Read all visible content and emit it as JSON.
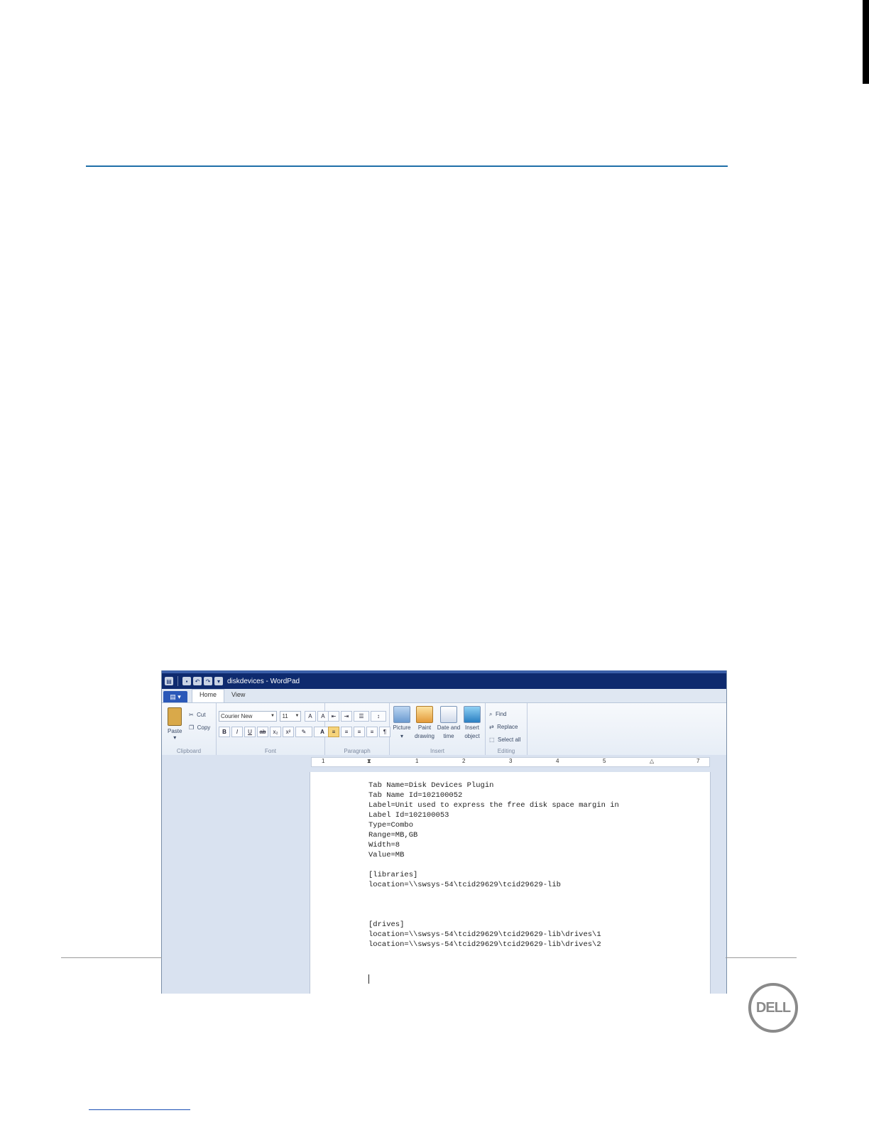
{
  "window": {
    "title": "diskdevices - WordPad"
  },
  "tabs": [
    {
      "label": "Home",
      "active": true
    },
    {
      "label": "View",
      "active": false
    }
  ],
  "ribbon": {
    "clipboard": {
      "label": "Clipboard",
      "paste": "Paste",
      "cut": "Cut",
      "copy": "Copy"
    },
    "font": {
      "label": "Font",
      "family": "Courier New",
      "size": "11"
    },
    "paragraph": {
      "label": "Paragraph"
    },
    "insert": {
      "label": "Insert",
      "picture": "Picture",
      "paint1": "Paint",
      "paint2": "drawing",
      "date1": "Date and",
      "date2": "time",
      "obj1": "Insert",
      "obj2": "object"
    },
    "editing": {
      "label": "Editing",
      "find": "Find",
      "replace": "Replace",
      "select_all": "Select all"
    }
  },
  "ruler": [
    "1",
    "1",
    "2",
    "3",
    "4",
    "5",
    "7"
  ],
  "document": {
    "lines": [
      "Tab Name=Disk Devices Plugin",
      "Tab Name Id=102100052",
      "Label=Unit used to express the free disk space margin in",
      "Label Id=102100053",
      "Type=Combo",
      "Range=MB,GB",
      "Width=8",
      "Value=MB",
      "",
      "[libraries]",
      "location=\\\\swsys-54\\tcid29629\\tcid29629-lib",
      "",
      "",
      "",
      "[drives]",
      "location=\\\\swsys-54\\tcid29629\\tcid29629-lib\\drives\\1",
      "location=\\\\swsys-54\\tcid29629\\tcid29629-lib\\drives\\2"
    ]
  },
  "footer": {
    "logo": "DELL"
  },
  "colors": {
    "rule": "#1f6fa8",
    "titlebar": "#0e2a6e"
  }
}
